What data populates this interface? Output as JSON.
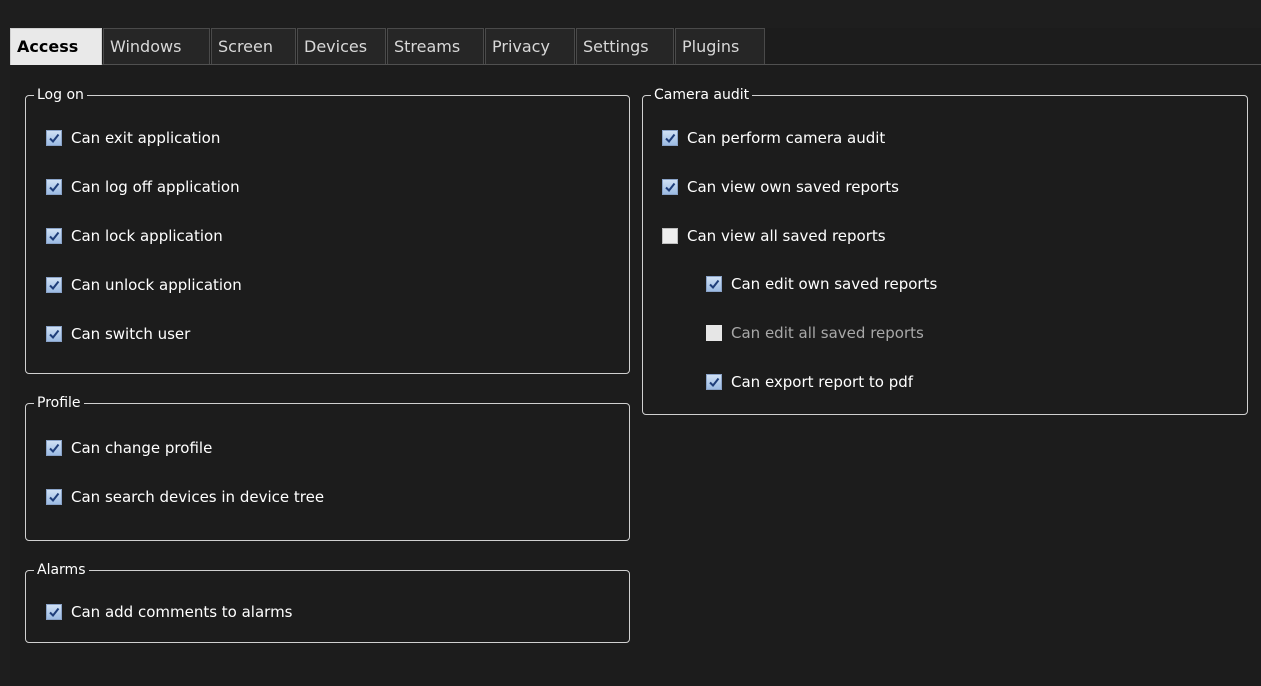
{
  "tabs": [
    {
      "label": "Access",
      "active": true
    },
    {
      "label": "Windows",
      "active": false
    },
    {
      "label": "Screen",
      "active": false
    },
    {
      "label": "Devices",
      "active": false
    },
    {
      "label": "Streams",
      "active": false
    },
    {
      "label": "Privacy",
      "active": false
    },
    {
      "label": "Settings",
      "active": false
    },
    {
      "label": "Plugins",
      "active": false
    }
  ],
  "groups": {
    "log_on": {
      "title": "Log on",
      "items": [
        {
          "label": "Can exit application",
          "checked": true
        },
        {
          "label": "Can log off application",
          "checked": true
        },
        {
          "label": "Can lock application",
          "checked": true
        },
        {
          "label": "Can unlock application",
          "checked": true
        },
        {
          "label": "Can switch user",
          "checked": true
        }
      ]
    },
    "profile": {
      "title": "Profile",
      "items": [
        {
          "label": "Can change profile",
          "checked": true
        },
        {
          "label": "Can search devices in device tree",
          "checked": true
        }
      ]
    },
    "alarms": {
      "title": "Alarms",
      "items": [
        {
          "label": "Can add comments to alarms",
          "checked": true
        }
      ]
    },
    "camera_audit": {
      "title": "Camera audit",
      "items": [
        {
          "label": "Can perform camera audit",
          "checked": true,
          "enabled": true
        },
        {
          "label": "Can view own saved reports",
          "checked": true,
          "enabled": true
        },
        {
          "label": "Can view all saved reports",
          "checked": false,
          "enabled": true
        },
        {
          "label": "Can edit own saved reports",
          "checked": true,
          "enabled": true
        },
        {
          "label": "Can edit all saved reports",
          "checked": false,
          "enabled": false
        },
        {
          "label": "Can export report to pdf",
          "checked": true,
          "enabled": true
        }
      ]
    }
  },
  "colors": {
    "checkbox_checked": "#9cbbe3",
    "checkmark": "#1f3e7a",
    "border": "#d0d0d0"
  }
}
